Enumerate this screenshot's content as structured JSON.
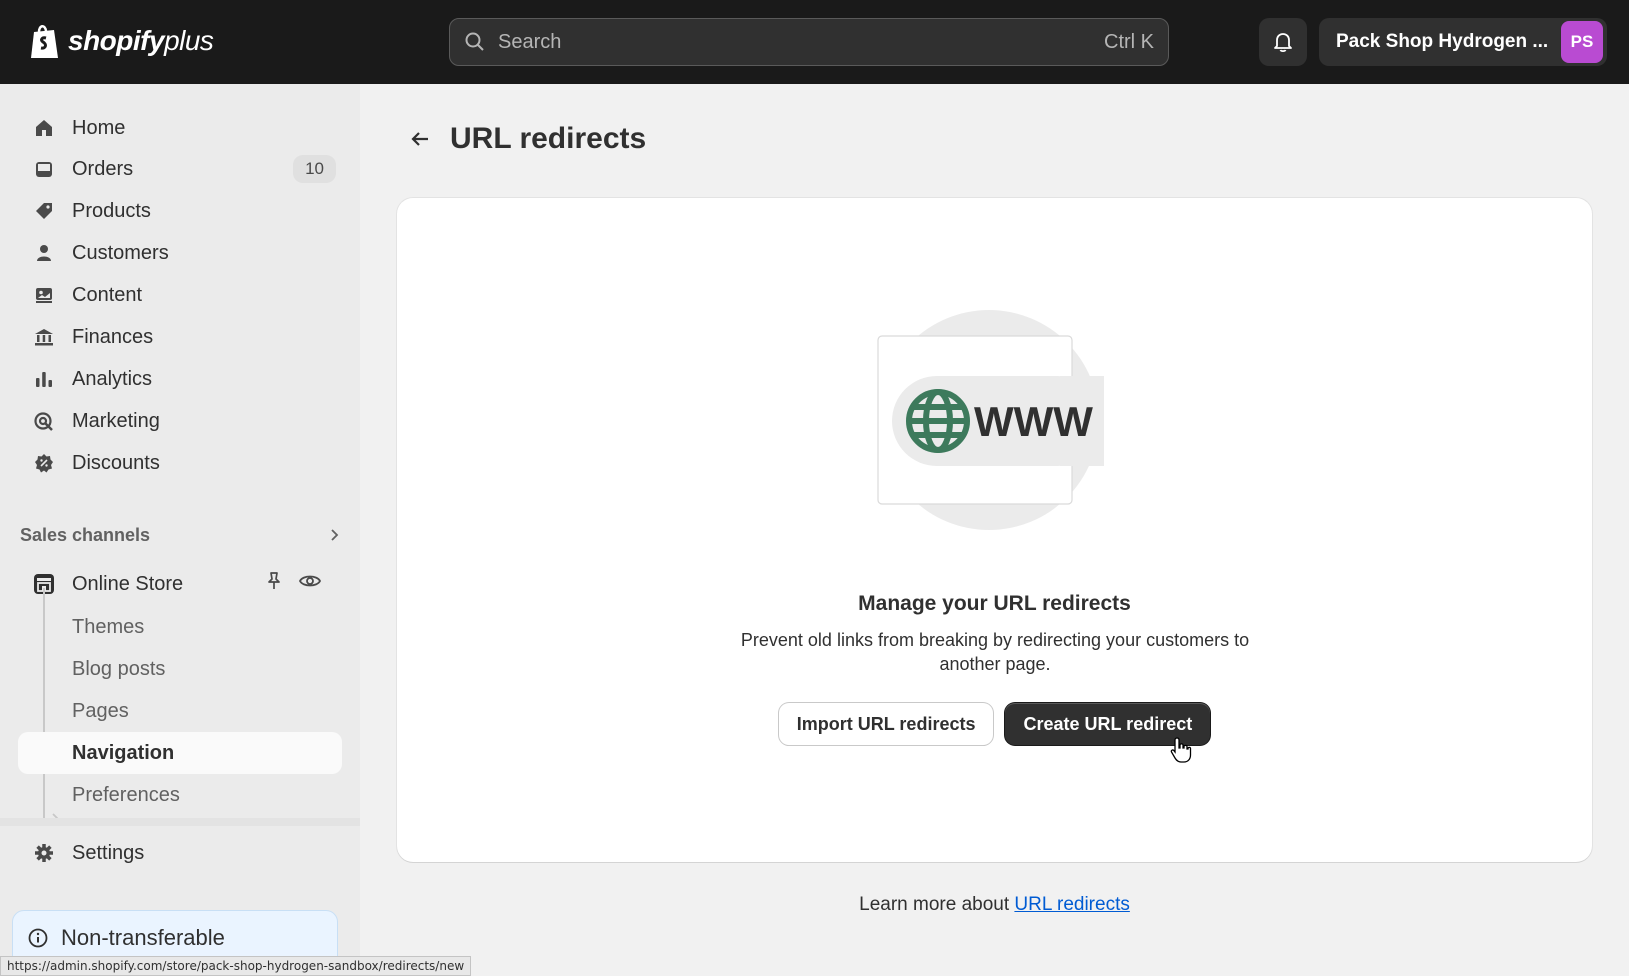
{
  "topbar": {
    "logo_text": "shopify",
    "logo_plus": "plus",
    "search_placeholder": "Search",
    "search_shortcut": "Ctrl K",
    "store_name": "Pack Shop Hydrogen ...",
    "avatar_initials": "PS"
  },
  "sidebar": {
    "items": [
      {
        "label": "Home",
        "icon": "home-icon"
      },
      {
        "label": "Orders",
        "icon": "inbox-icon",
        "badge": "10"
      },
      {
        "label": "Products",
        "icon": "tag-icon"
      },
      {
        "label": "Customers",
        "icon": "person-icon"
      },
      {
        "label": "Content",
        "icon": "image-icon"
      },
      {
        "label": "Finances",
        "icon": "bank-icon"
      },
      {
        "label": "Analytics",
        "icon": "bar-chart-icon"
      },
      {
        "label": "Marketing",
        "icon": "target-icon"
      },
      {
        "label": "Discounts",
        "icon": "discount-icon"
      }
    ],
    "sales_channels_label": "Sales channels",
    "online_store_label": "Online Store",
    "sub_items": [
      {
        "label": "Themes"
      },
      {
        "label": "Blog posts"
      },
      {
        "label": "Pages"
      },
      {
        "label": "Navigation",
        "active": true
      },
      {
        "label": "Preferences"
      }
    ],
    "settings_label": "Settings",
    "notice_label": "Non-transferable"
  },
  "main": {
    "page_title": "URL redirects",
    "illustration_text": "WWW",
    "empty_title": "Manage your URL redirects",
    "empty_description": "Prevent old links from breaking by redirecting your customers to another page.",
    "import_button": "Import URL redirects",
    "create_button": "Create URL redirect",
    "learn_more_prefix": "Learn more about ",
    "learn_more_link": "URL redirects"
  },
  "statusbar": {
    "url": "https://admin.shopify.com/store/pack-shop-hydrogen-sandbox/redirects/new"
  },
  "colors": {
    "topbar": "#1a1a1a",
    "avatar": "#b94bd2",
    "globe": "#3d7a5c",
    "link": "#005bd3"
  }
}
